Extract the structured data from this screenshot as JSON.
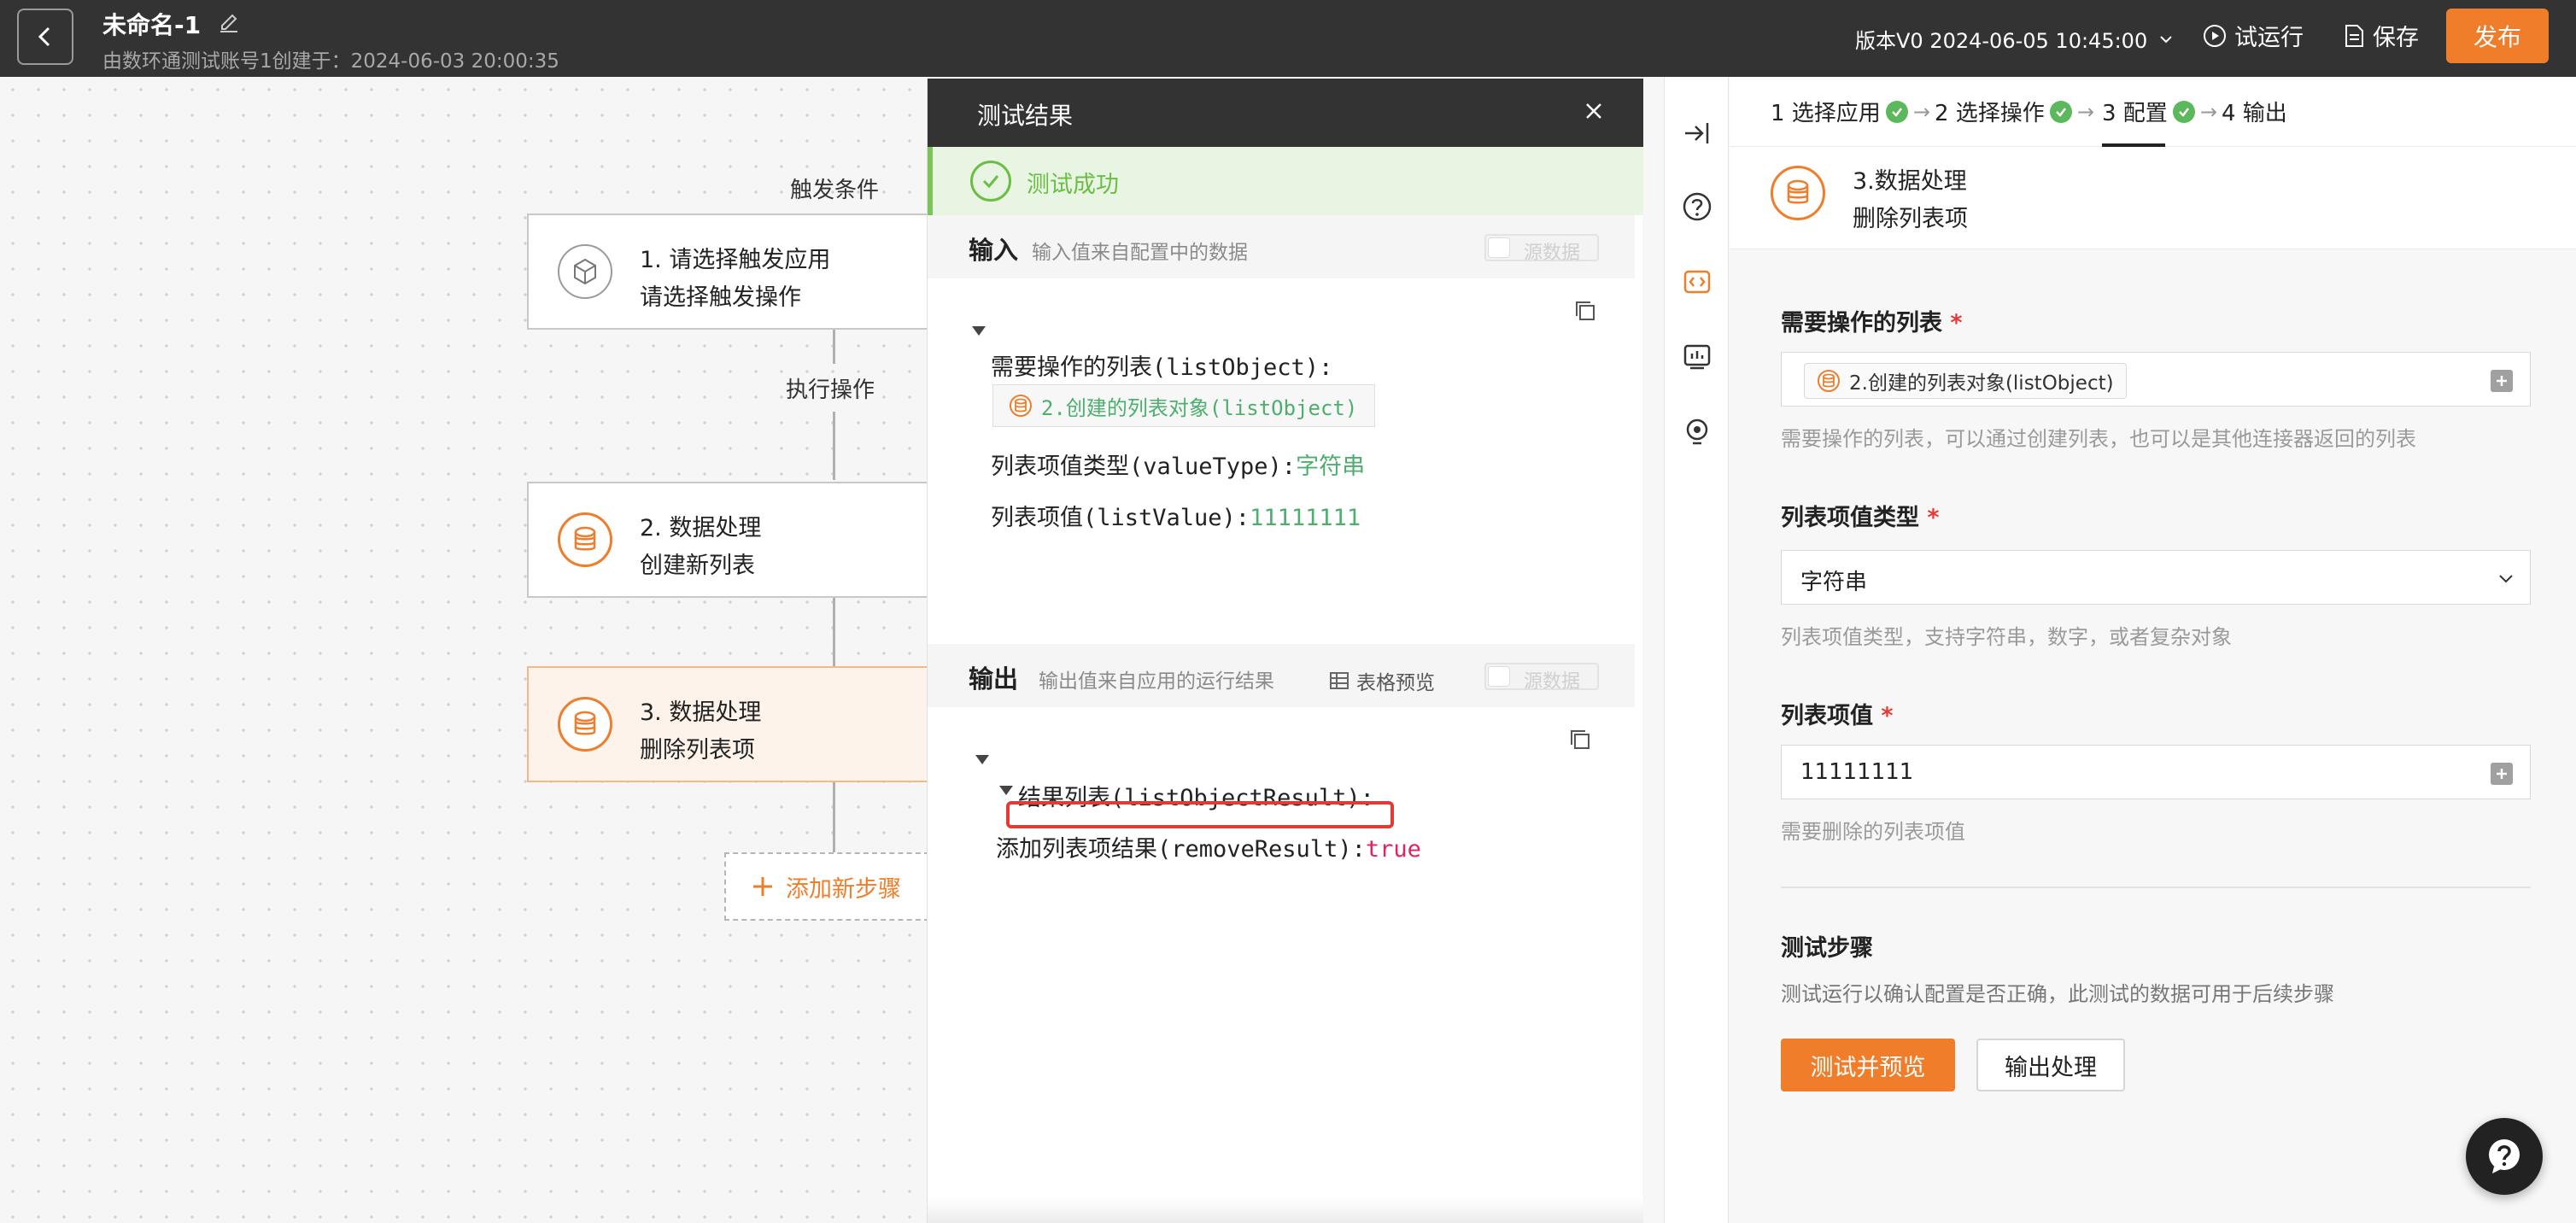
{
  "topbar": {
    "title": "未命名-1",
    "subtitle": "由数环通测试账号1创建于：2024-06-03 20:00:35",
    "version": "版本V0 2024-06-05 10:45:00",
    "trial_run": "试运行",
    "save": "保存",
    "publish": "发布"
  },
  "flow": {
    "trigger_label": "触发条件",
    "action_label": "执行操作",
    "nodes": [
      {
        "line1": "1. 请选择触发应用",
        "line2": "请选择触发操作"
      },
      {
        "line1": "2. 数据处理",
        "line2": "创建新列表"
      },
      {
        "line1": "3. 数据处理",
        "line2": "删除列表项"
      }
    ],
    "add_step": "添加新步骤"
  },
  "test_result": {
    "title": "测试结果",
    "success": "测试成功",
    "input": {
      "title": "输入",
      "hint": "输入值来自配置中的数据",
      "raw_toggle": "源数据",
      "list_object_key": "需要操作的列表(listObject):",
      "list_object_chip": "2.创建的列表对象(listObject)",
      "value_type_key": "列表项值类型(valueType):",
      "value_type_val": "字符串",
      "list_value_key": "列表项值(listValue):",
      "list_value_val": "11111111"
    },
    "output": {
      "title": "输出",
      "hint": "输出值来自应用的运行结果",
      "table_preview": "表格预览",
      "raw_toggle": "源数据",
      "result_key": "结果列表(listObjectResult):",
      "remove_key": "添加列表项结果(removeResult):",
      "remove_val": "true"
    }
  },
  "config": {
    "steps": [
      {
        "label": "1 选择应用",
        "done": true
      },
      {
        "label": "2 选择操作",
        "done": true
      },
      {
        "label": "3 配置",
        "done": true
      },
      {
        "label": "4 输出",
        "done": false
      }
    ],
    "node_title": "3.数据处理",
    "node_subtitle": "删除列表项",
    "fields": {
      "list": {
        "label": "需要操作的列表",
        "chip": "2.创建的列表对象(listObject)",
        "hint": "需要操作的列表，可以通过创建列表，也可以是其他连接器返回的列表"
      },
      "value_type": {
        "label": "列表项值类型",
        "value": "字符串",
        "hint": "列表项值类型，支持字符串，数字，或者复杂对象"
      },
      "value": {
        "label": "列表项值",
        "value": "11111111",
        "hint": "需要删除的列表项值"
      }
    },
    "required_mark": "*",
    "test_step": {
      "title": "测试步骤",
      "desc": "测试运行以确认配置是否正确，此测试的数据可用于后续步骤",
      "preview_btn": "测试并预览",
      "output_btn": "输出处理"
    }
  },
  "colors": {
    "accent": "#ef7d2a",
    "success": "#6bbd45",
    "topbar": "#333333",
    "highlight": "#e53935"
  },
  "icons": [
    "back-icon",
    "edit-icon",
    "play-icon",
    "document-icon",
    "close-icon",
    "check-circle-icon",
    "copy-icon",
    "table-icon",
    "collapse-right-icon",
    "help-circle-icon",
    "code-icon",
    "monitor-icon",
    "bulb-icon",
    "database-icon",
    "plus-icon",
    "chevron-down-icon",
    "question-icon"
  ]
}
